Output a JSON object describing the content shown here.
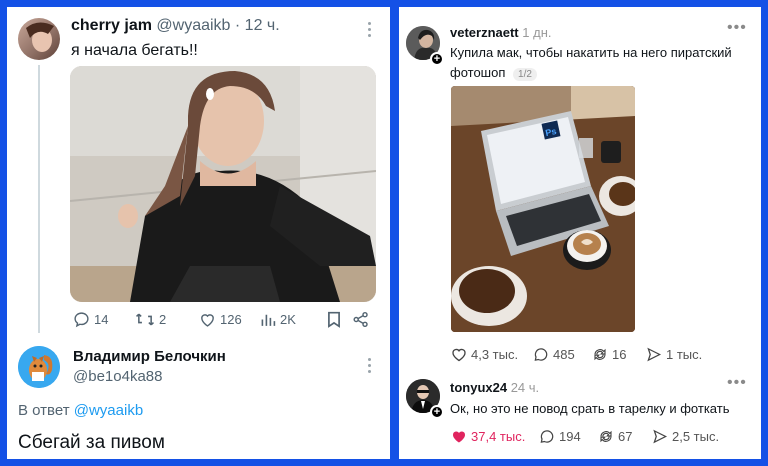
{
  "left_post": {
    "author_name": "cherry jam",
    "author_handle": "@wyaaikb",
    "time": "· 12 ч.",
    "text": "я начала бегать!!",
    "actions": {
      "replies": "14",
      "retweets": "2",
      "likes": "126",
      "views": "2K"
    }
  },
  "left_reply": {
    "author_name": "Владимир Белочкин",
    "author_handle": "@be1o4ka88",
    "in_reply_prefix": "В ответ",
    "in_reply_handle": "@wyaaikb",
    "text": "Сбегай за пивом"
  },
  "right_post": {
    "author_name": "veterznaett",
    "time": "1 дн.",
    "text_line1": "Купила мак, чтобы накатить на него пиратский",
    "text_line2": "фотошоп",
    "page_indicator": "1/2",
    "actions": {
      "likes": "4,3 тыс.",
      "comments": "485",
      "reposts": "16",
      "shares": "1 тыс."
    }
  },
  "right_reply": {
    "author_name": "tonyux24",
    "time": "24 ч.",
    "text": "Ок, но это не повод срать в тарелку и фоткать",
    "actions": {
      "likes": "37,4 тыс.",
      "comments": "194",
      "reposts": "67",
      "shares": "2,5 тыс."
    }
  },
  "colors": {
    "background": "#1451e6",
    "like_active": "#e0245e",
    "link": "#1d9bf0"
  },
  "icons": [
    "reply-icon",
    "retweet-icon",
    "like-icon",
    "views-icon",
    "bookmark-icon",
    "share-icon",
    "more-icon",
    "heart-icon",
    "comment-icon",
    "repost-icon",
    "send-icon"
  ]
}
